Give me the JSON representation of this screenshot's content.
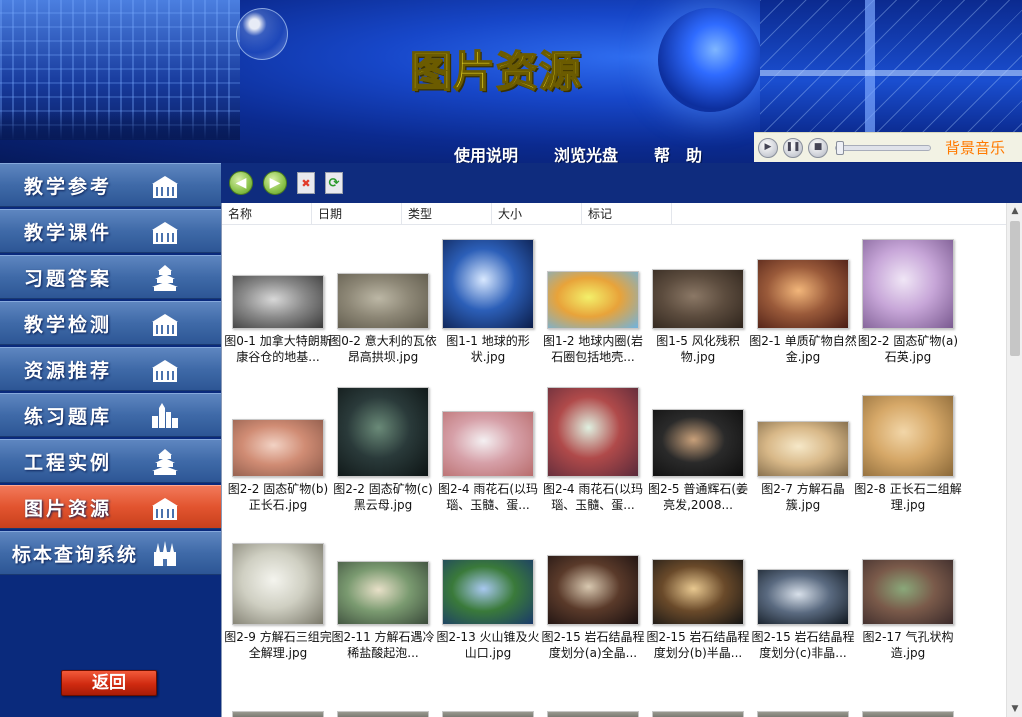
{
  "banner": {
    "title": "图片资源"
  },
  "top_nav": [
    "使用说明",
    "浏览光盘",
    "帮　助"
  ],
  "music_player": {
    "label": "背景音乐",
    "volume": 0.0
  },
  "sidebar": {
    "items": [
      {
        "label": "教学参考",
        "icon": "building-icon",
        "active": false
      },
      {
        "label": "教学课件",
        "icon": "building-icon",
        "active": false
      },
      {
        "label": "习题答案",
        "icon": "pagoda-icon",
        "active": false
      },
      {
        "label": "教学检测",
        "icon": "building-icon",
        "active": false
      },
      {
        "label": "资源推荐",
        "icon": "building-icon",
        "active": false
      },
      {
        "label": "练习题库",
        "icon": "city-icon",
        "active": false
      },
      {
        "label": "工程实例",
        "icon": "pagoda-icon",
        "active": false
      },
      {
        "label": "图片资源",
        "icon": "building-icon",
        "active": true
      },
      {
        "label": "标本查询系统",
        "icon": "castle-icon",
        "active": false
      }
    ],
    "back_label": "返回"
  },
  "toolbar": {
    "buttons": [
      "back-arrow-icon",
      "forward-arrow-icon",
      "delete-icon",
      "refresh-icon"
    ]
  },
  "columns": [
    "名称",
    "日期",
    "类型",
    "大小",
    "标记"
  ],
  "files": [
    {
      "caption": "图0-1 加拿大特朗斯康谷仓的地基...",
      "colors": [
        "#d8d8d8",
        "#8a8a8a",
        "#3a3a3a"
      ]
    },
    {
      "caption": "图0-2 意大利的瓦依昂高拱坝.jpg",
      "colors": [
        "#bcb7a5",
        "#8d8776",
        "#5d584a"
      ]
    },
    {
      "caption": "图1-1 地球的形状.jpg",
      "colors": [
        "#d8e8ff",
        "#2c5fb8",
        "#0b1d4a"
      ]
    },
    {
      "caption": "图1-2 地球内圈(岩石圈包括地壳...",
      "colors": [
        "#f3f06a",
        "#e8a33a",
        "#6fb3e0"
      ]
    },
    {
      "caption": "图1-5 风化残积物.jpg",
      "colors": [
        "#8b7866",
        "#5c4c3e",
        "#2e241c"
      ]
    },
    {
      "caption": "图2-1 单质矿物自然金.jpg",
      "colors": [
        "#f2b67a",
        "#9a5a3a",
        "#4a1c14"
      ]
    },
    {
      "caption": "图2-2 固态矿物(a)石英.jpg",
      "colors": [
        "#f0e6f6",
        "#c7a6d8",
        "#7a5a90"
      ]
    },
    {
      "caption": "图2-2 固态矿物(b)正长石.jpg",
      "colors": [
        "#f2d2c4",
        "#d08c74",
        "#8c5a4a"
      ]
    },
    {
      "caption": "图2-2 固态矿物(c)黑云母.jpg",
      "colors": [
        "#6a8a78",
        "#2a3a3a",
        "#0d1414"
      ]
    },
    {
      "caption": "图2-4 雨花石(以玛瑙、玉髓、蛋...",
      "colors": [
        "#f4f0f2",
        "#d6a0a8",
        "#b86c6c"
      ]
    },
    {
      "caption": "图2-4 雨花石(以玛瑙、玉髓、蛋...",
      "colors": [
        "#dff0e0",
        "#b04a4a",
        "#5a2a3a"
      ]
    },
    {
      "caption": "图2-5 普通辉石(姜亮发,2008...",
      "colors": [
        "#c8a07a",
        "#2a2a2a",
        "#0e0e0e"
      ]
    },
    {
      "caption": "图2-7 方解石晶簇.jpg",
      "colors": [
        "#f6e8c8",
        "#d8b888",
        "#7a6444"
      ]
    },
    {
      "caption": "图2-8 正长石二组解理.jpg",
      "colors": [
        "#f2d6a8",
        "#d6a868",
        "#8a6838"
      ]
    },
    {
      "caption": "图2-9 方解石三组完全解理.jpg",
      "colors": [
        "#f4f4ee",
        "#cfcfc2",
        "#7a786a"
      ]
    },
    {
      "caption": "图2-11 方解石遇冷稀盐酸起泡...",
      "colors": [
        "#e8e0c8",
        "#7a9a70",
        "#3a4a3a"
      ]
    },
    {
      "caption": "图2-13 火山锥及火山口.jpg",
      "colors": [
        "#a8c8f0",
        "#3a7a3a",
        "#1a3a6a"
      ]
    },
    {
      "caption": "图2-15 岩石结晶程度划分(a)全晶...",
      "colors": [
        "#d8c8b0",
        "#5a3a2a",
        "#1a1010"
      ]
    },
    {
      "caption": "图2-15 岩石结晶程度划分(b)半晶...",
      "colors": [
        "#e8c890",
        "#6a4a2a",
        "#141414"
      ]
    },
    {
      "caption": "图2-15 岩石结晶程度划分(c)非晶...",
      "colors": [
        "#d8e0ea",
        "#5a6a80",
        "#101820"
      ]
    },
    {
      "caption": "图2-17 气孔状构造.jpg",
      "colors": [
        "#8aa87a",
        "#7a5a4a",
        "#3a2a2a"
      ]
    }
  ]
}
